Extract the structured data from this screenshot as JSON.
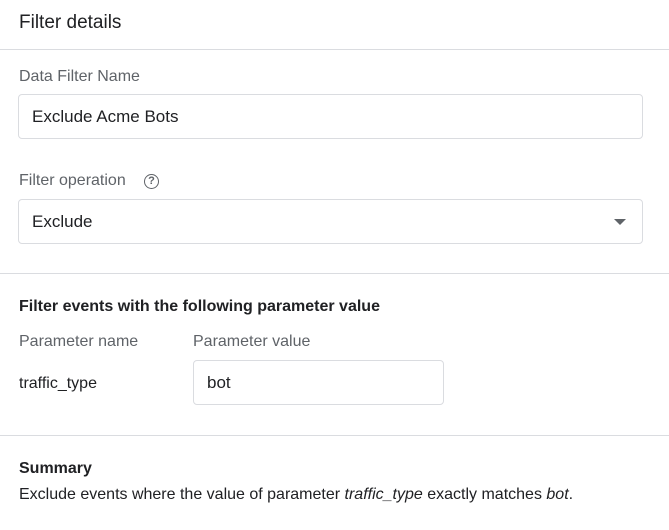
{
  "header": {
    "title": "Filter details"
  },
  "filter_name": {
    "label": "Data Filter Name",
    "value": "Exclude Acme Bots"
  },
  "filter_operation": {
    "label": "Filter operation",
    "help_icon": "help-circle-icon",
    "selected": "Exclude",
    "dropdown_icon": "caret-down-icon"
  },
  "parameter_section": {
    "title": "Filter events with the following parameter value",
    "name_header": "Parameter name",
    "value_header": "Parameter value",
    "name": "traffic_type",
    "value": "bot"
  },
  "summary": {
    "title": "Summary",
    "prefix": "Exclude events where the value of parameter ",
    "param": "traffic_type",
    "middle": " exactly matches ",
    "value": "bot",
    "suffix": "."
  }
}
